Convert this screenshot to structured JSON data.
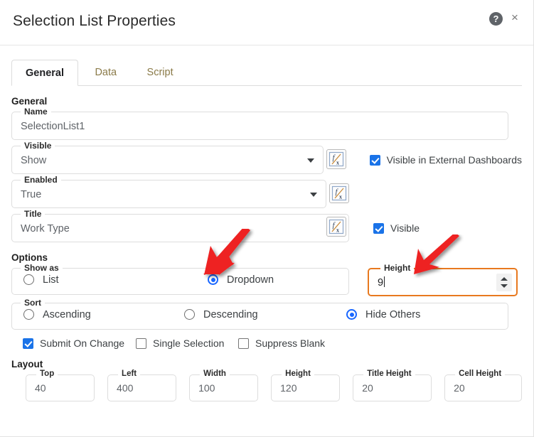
{
  "header": {
    "title": "Selection List Properties",
    "help_icon": "question-mark-icon",
    "help_glyph": "?",
    "close_icon": "close-icon",
    "close_glyph": "×"
  },
  "tabs": [
    {
      "label": "General",
      "active": true
    },
    {
      "label": "Data",
      "active": false
    },
    {
      "label": "Script",
      "active": false
    }
  ],
  "general": {
    "section_label": "General",
    "name": {
      "label": "Name",
      "value": "SelectionList1"
    },
    "visible": {
      "label": "Visible",
      "value": "Show"
    },
    "enabled": {
      "label": "Enabled",
      "value": "True"
    },
    "title": {
      "label": "Title",
      "value": "Work Type"
    },
    "visible_external_dashboards": {
      "label": "Visible in External Dashboards",
      "checked": true
    },
    "visible_checkbox": {
      "label": "Visible",
      "checked": true
    }
  },
  "options": {
    "section_label": "Options",
    "show_as": {
      "label": "Show as",
      "choices": [
        {
          "label": "List",
          "selected": false
        },
        {
          "label": "Dropdown",
          "selected": true
        }
      ]
    },
    "height": {
      "label": "Height",
      "value": "9"
    },
    "sort": {
      "label": "Sort",
      "choices": [
        {
          "label": "Ascending",
          "selected": false
        },
        {
          "label": "Descending",
          "selected": false
        },
        {
          "label": "Hide Others",
          "selected": true
        }
      ]
    },
    "checkboxes": [
      {
        "label": "Submit On Change",
        "checked": true
      },
      {
        "label": "Single Selection",
        "checked": false
      },
      {
        "label": "Suppress Blank",
        "checked": false
      }
    ]
  },
  "layout": {
    "section_label": "Layout",
    "fields": [
      {
        "label": "Top",
        "value": "40"
      },
      {
        "label": "Left",
        "value": "400"
      },
      {
        "label": "Width",
        "value": "100"
      },
      {
        "label": "Height",
        "value": "120"
      },
      {
        "label": "Title Height",
        "value": "20"
      },
      {
        "label": "Cell Height",
        "value": "20"
      }
    ]
  },
  "annotations": {
    "arrow_color": "#ee2222",
    "arrows": [
      {
        "name": "arrow-to-dropdown-radio"
      },
      {
        "name": "arrow-to-height-field"
      }
    ]
  },
  "colors": {
    "accent_blue": "#1a73e8",
    "radio_blue": "#1967ff",
    "focus_orange": "#e8791f",
    "tab_inactive": "#8a7a48"
  }
}
